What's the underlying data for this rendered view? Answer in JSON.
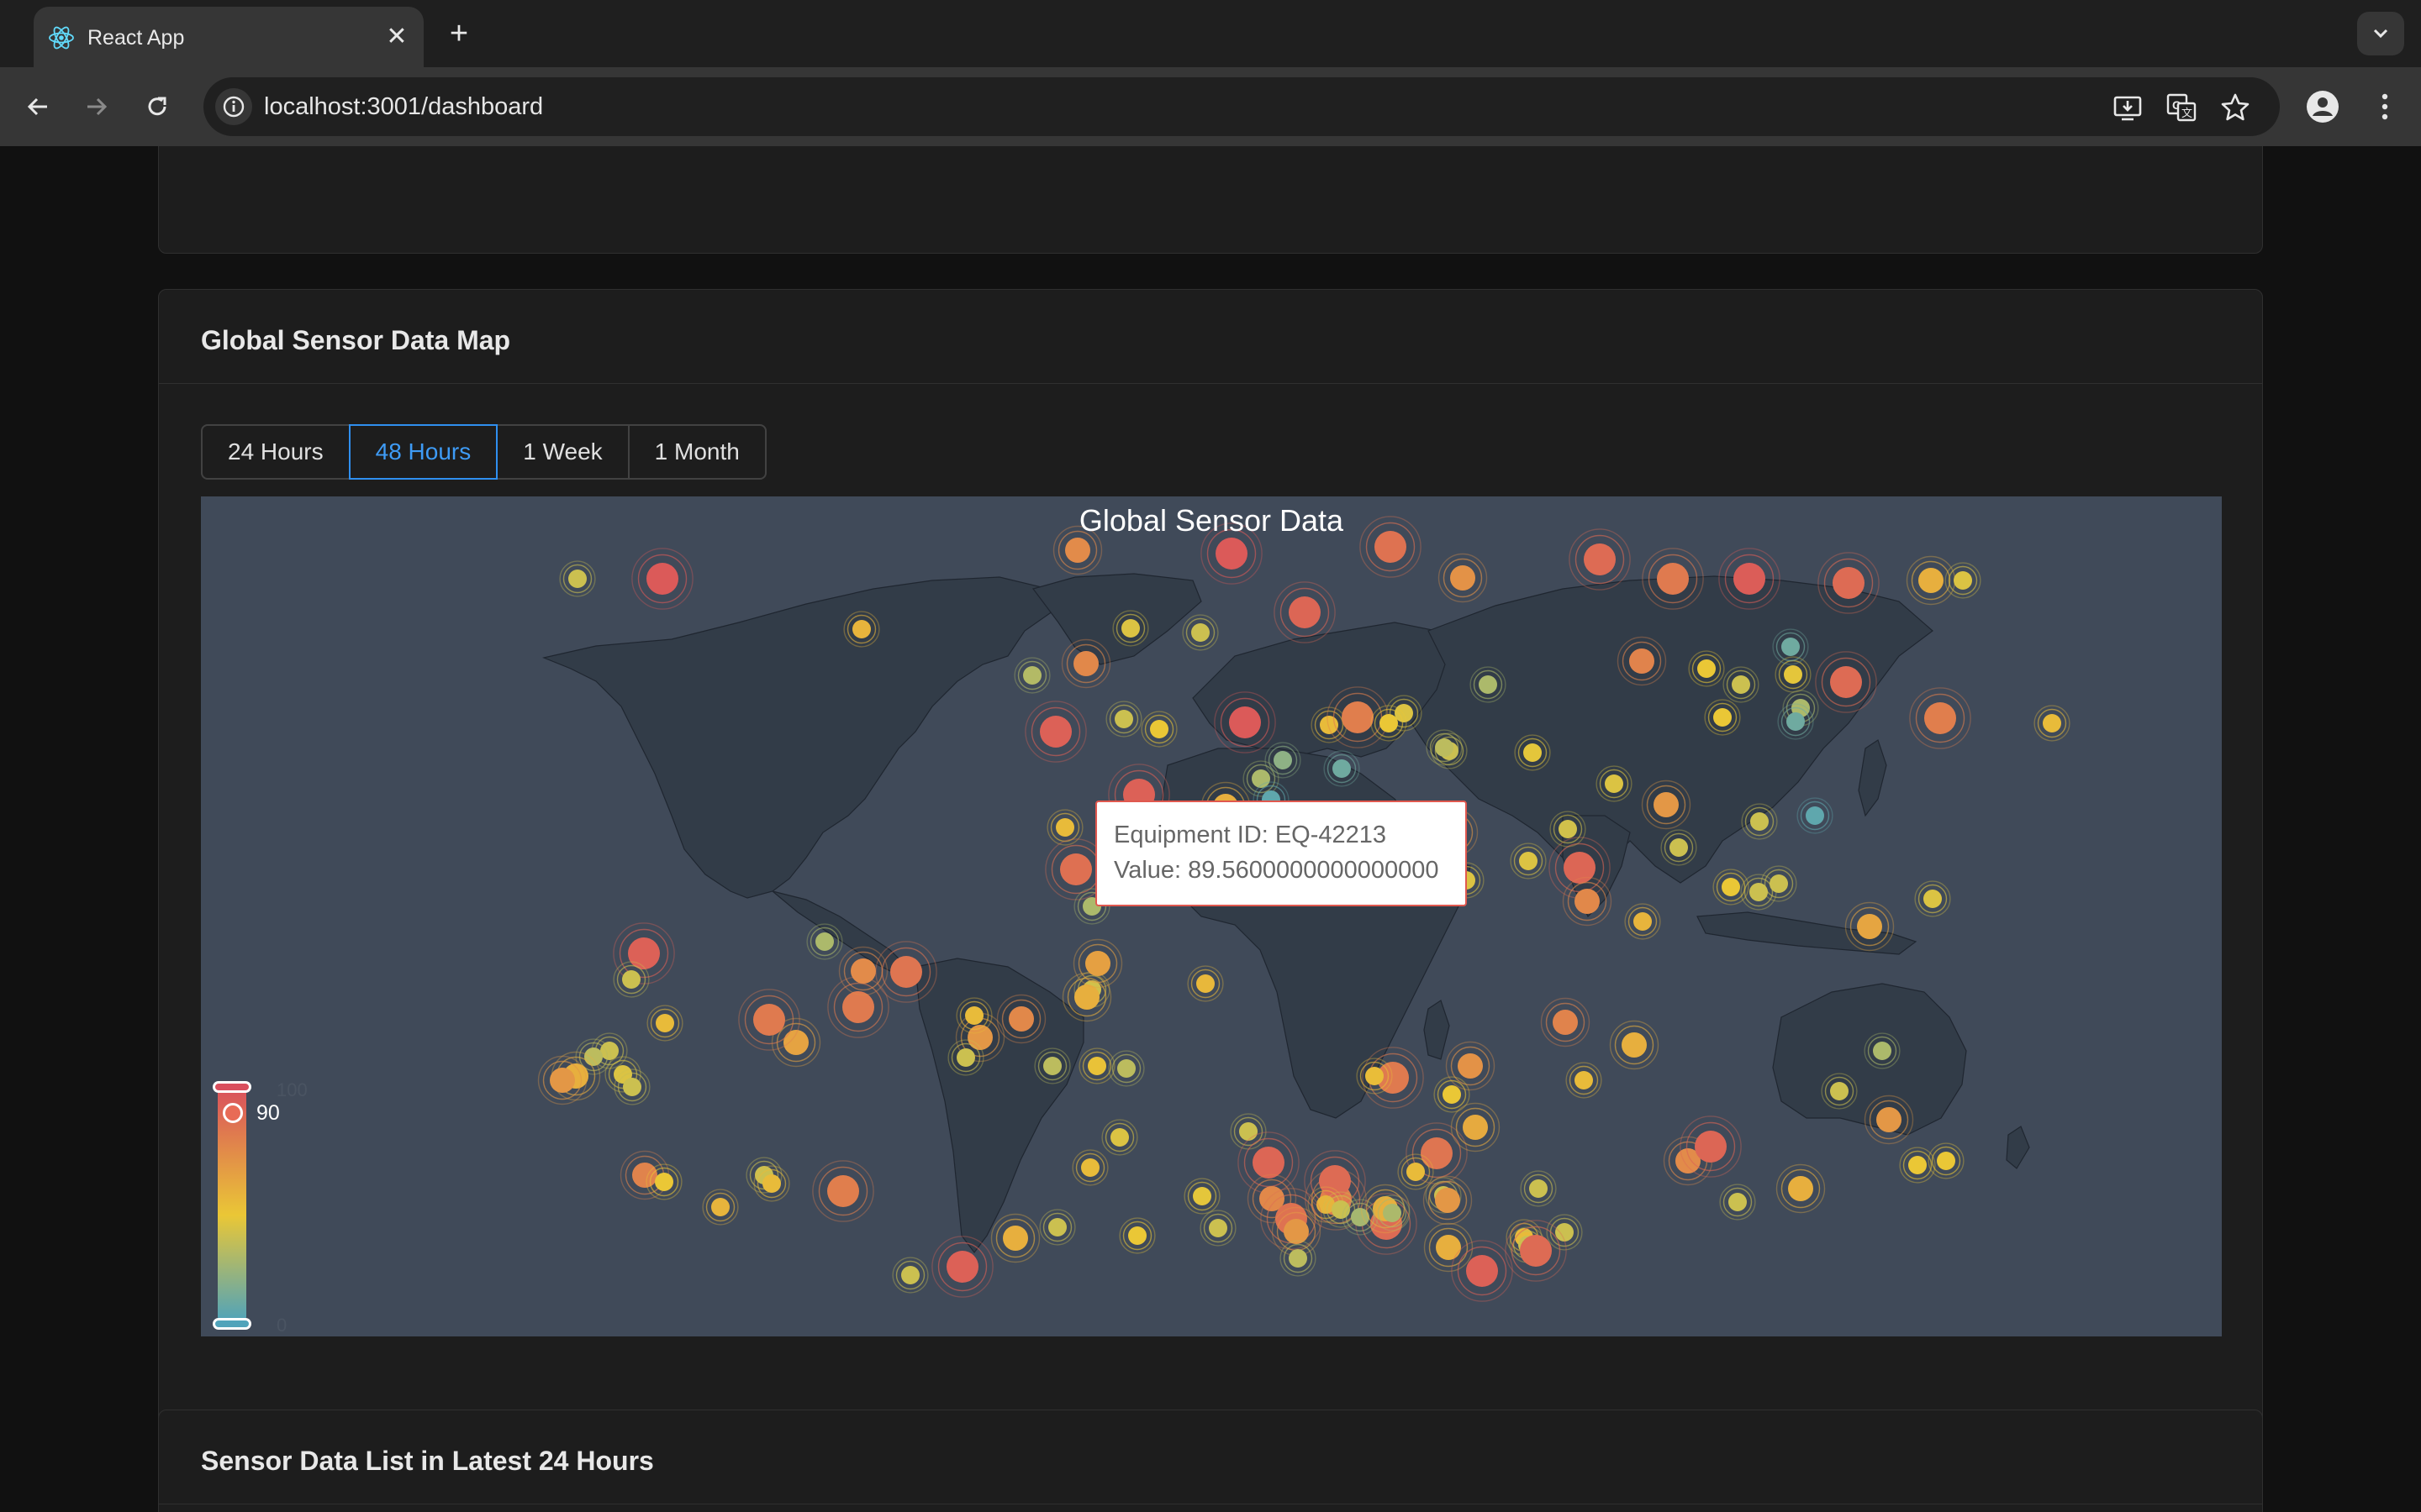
{
  "browser": {
    "tab_title": "React App",
    "tab_close": "✕",
    "new_tab": "+",
    "url": "localhost:3001/dashboard"
  },
  "dashboard": {
    "map_card": {
      "title": "Global Sensor Data Map",
      "ranges": [
        "24 Hours",
        "48 Hours",
        "1 Week",
        "1 Month"
      ],
      "selected_range": "48 Hours",
      "chart_title": "Global Sensor Data",
      "tooltip": {
        "line1": "Equipment ID: EQ-42213",
        "line2": "Value: 89.5600000000000000"
      },
      "visual_map": {
        "max_label": "100",
        "min_label": "0",
        "current_label": "90",
        "colors": [
          "#d94e5d",
          "#eac736",
          "#50a3ba"
        ]
      }
    },
    "list_card": {
      "title": "Sensor Data List in Latest 24 Hours"
    }
  },
  "chart_data": {
    "type": "scatter",
    "title": "Global Sensor Data",
    "value_range": [
      0,
      100
    ],
    "highlighted": {
      "equipment_id": "EQ-42213",
      "value": 89.56
    }
  }
}
